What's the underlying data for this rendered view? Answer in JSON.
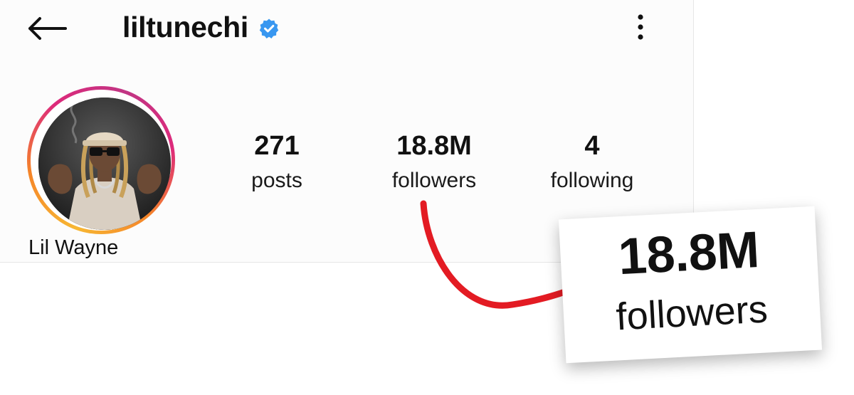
{
  "header": {
    "username": "liltunechi",
    "back_icon": "arrow-left-icon",
    "verified_icon": "verified-badge-icon",
    "more_icon": "more-vertical-icon",
    "verified_color": "#3897f0"
  },
  "profile": {
    "display_name": "Lil Wayne",
    "avatar": "profile-photo",
    "story_ring_colors": [
      "#f7b733",
      "#f58529",
      "#dd2a7b",
      "#c13584"
    ]
  },
  "stats": {
    "posts": {
      "value": "271",
      "label": "posts"
    },
    "followers": {
      "value": "18.8M",
      "label": "followers"
    },
    "following": {
      "value": "4",
      "label": "following"
    }
  },
  "callout": {
    "value": "18.8M",
    "label": "followers",
    "arrow_color": "#e31b23"
  }
}
